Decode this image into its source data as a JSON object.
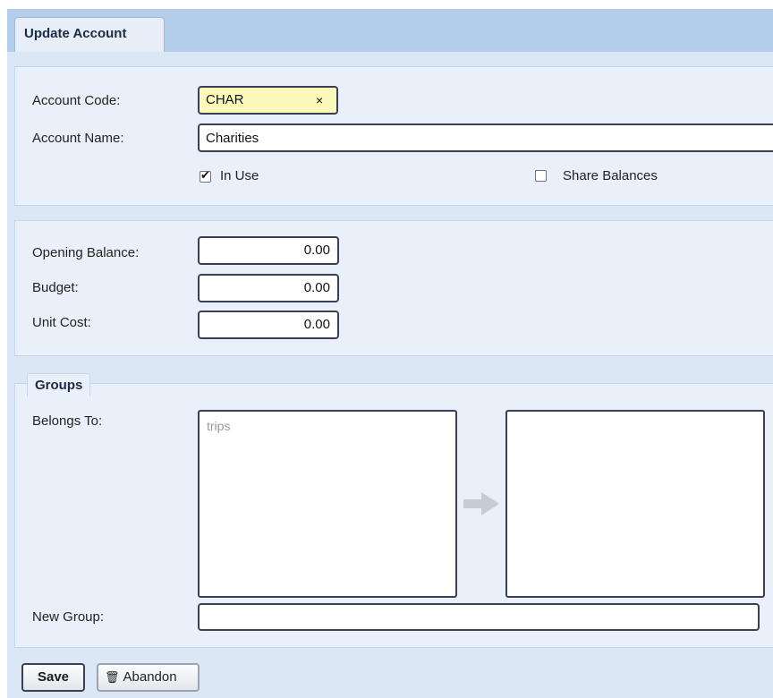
{
  "tab": {
    "label": "Update Account"
  },
  "account": {
    "code_label": "Account Code:",
    "code_value": "CHAR",
    "clear_glyph": "×",
    "name_label": "Account Name:",
    "name_value": "Charities",
    "in_use_label": "In Use",
    "in_use_checked": true,
    "share_balances_label": "Share Balances",
    "share_balances_checked": false
  },
  "balances": {
    "opening_label": "Opening Balance:",
    "opening_value": "0.00",
    "budget_label": "Budget:",
    "budget_value": "0.00",
    "unit_cost_label": "Unit Cost:",
    "unit_cost_value": "0.00"
  },
  "groups": {
    "legend": "Groups",
    "belongs_to_label": "Belongs To:",
    "available_items": [
      "trips"
    ],
    "assigned_items": [],
    "move_icon": "arrow-right-icon",
    "new_group_label": "New Group:",
    "new_group_value": ""
  },
  "buttons": {
    "save_label": "Save",
    "abandon_label": "Abandon",
    "abandon_icon": "trash-icon"
  },
  "colors": {
    "code_field_bg": "#fbf9b9",
    "tabbar_bg": "#b3cdea",
    "panel_bg": "#eaf0f9"
  }
}
